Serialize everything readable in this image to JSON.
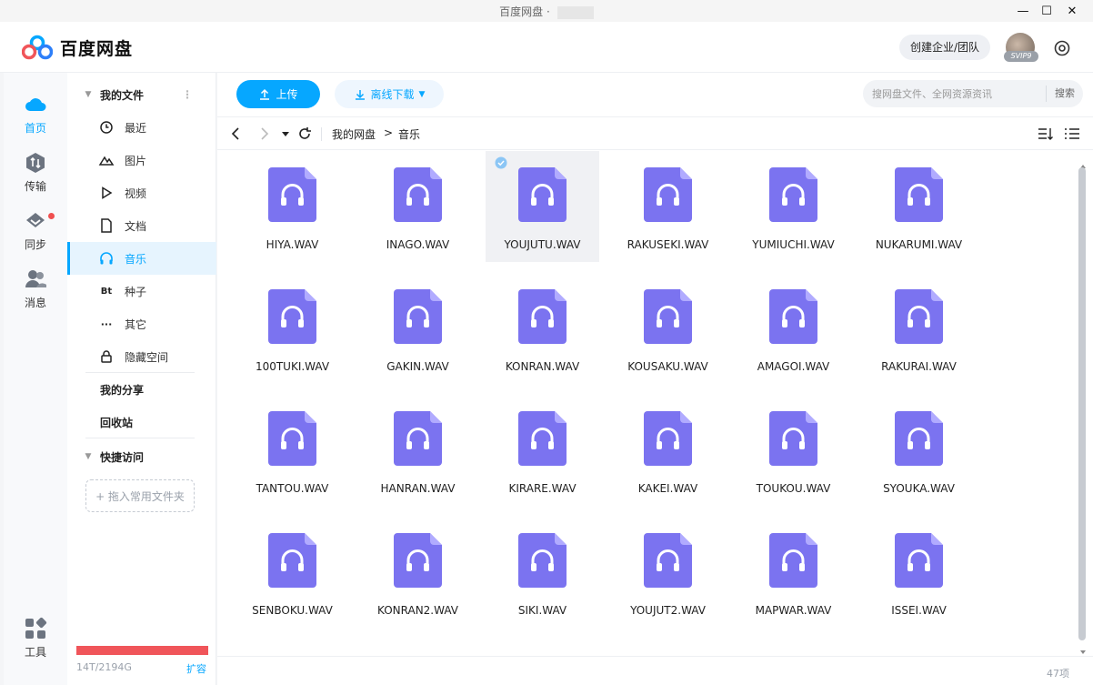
{
  "window": {
    "title": "百度网盘 ·",
    "minimize": "—",
    "maximize": "☐",
    "close": "✕"
  },
  "header": {
    "logo_text": "百度网盘",
    "team_button": "创建企业/团队",
    "vip_badge": "SVIP9"
  },
  "rail": {
    "items": [
      {
        "label": "首页",
        "icon": "cloud-icon"
      },
      {
        "label": "传输",
        "icon": "transfer-icon"
      },
      {
        "label": "同步",
        "icon": "sync-icon"
      },
      {
        "label": "消息",
        "icon": "message-icon"
      },
      {
        "label": "工具",
        "icon": "tools-icon"
      }
    ]
  },
  "nav": {
    "my_files": "我的文件",
    "items": [
      {
        "label": "最近",
        "icon": "clock-icon"
      },
      {
        "label": "图片",
        "icon": "image-icon"
      },
      {
        "label": "视频",
        "icon": "play-icon"
      },
      {
        "label": "文档",
        "icon": "document-icon"
      },
      {
        "label": "音乐",
        "icon": "headphones-icon"
      },
      {
        "label": "种子",
        "icon": "bt-icon",
        "glyph": "Bt"
      },
      {
        "label": "其它",
        "icon": "more-icon",
        "glyph": "···"
      },
      {
        "label": "隐藏空间",
        "icon": "lock-icon"
      }
    ],
    "my_share": "我的分享",
    "recycle_bin": "回收站",
    "quick_access": "快捷访问",
    "drop_hint": "+ 拖入常用文件夹",
    "storage_text": "14T/2194G",
    "expand_label": "扩容"
  },
  "toolbar": {
    "upload_label": "上传",
    "offline_label": "离线下载",
    "search_placeholder": "搜网盘文件、全网资源资讯",
    "search_button": "搜索"
  },
  "path": {
    "root": "我的网盘",
    "separator": ">",
    "current": "音乐"
  },
  "files": [
    "HIYA.WAV",
    "INAGO.WAV",
    "YOUJUTU.WAV",
    "RAKUSEKI.WAV",
    "YUMIUCHI.WAV",
    "NUKARUMI.WAV",
    "100TUKI.WAV",
    "GAKIN.WAV",
    "KONRAN.WAV",
    "KOUSAKU.WAV",
    "AMAGOI.WAV",
    "RAKURAI.WAV",
    "TANTOU.WAV",
    "HANRAN.WAV",
    "KIRARE.WAV",
    "KAKEI.WAV",
    "TOUKOU.WAV",
    "SYOUKA.WAV",
    "SENBOKU.WAV",
    "KONRAN2.WAV",
    "SIKI.WAV",
    "YOUJUT2.WAV",
    "MAPWAR.WAV",
    "ISSEI.WAV"
  ],
  "selected_file": "YOUJUTU.WAV",
  "item_count": "47项",
  "colors": {
    "accent": "#06a7ff",
    "file_icon": "#7b73f0",
    "storage_bar": "#f0555a"
  }
}
